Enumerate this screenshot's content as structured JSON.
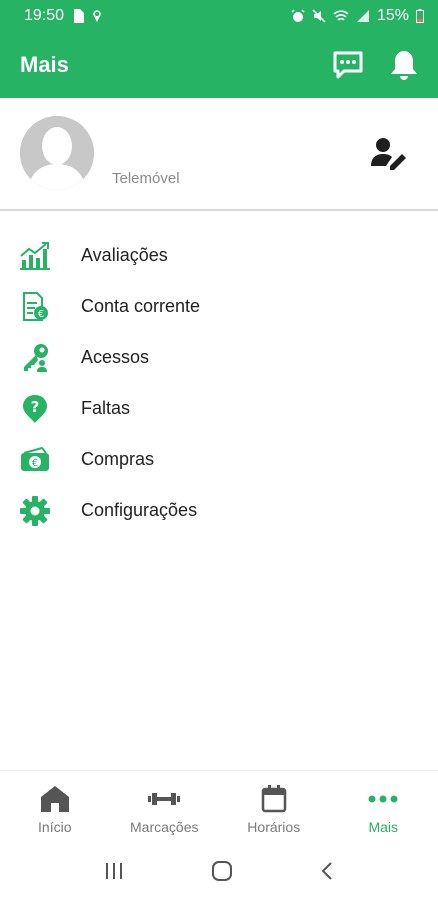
{
  "status": {
    "time": "19:50",
    "battery": "15%"
  },
  "header": {
    "title": "Mais"
  },
  "profile": {
    "phone_label": "Telemóvel"
  },
  "menu": {
    "items": [
      {
        "label": "Avaliações",
        "icon": "bar-chart-icon"
      },
      {
        "label": "Conta corrente",
        "icon": "invoice-euro-icon"
      },
      {
        "label": "Acessos",
        "icon": "key-icon"
      },
      {
        "label": "Faltas",
        "icon": "question-pin-icon"
      },
      {
        "label": "Compras",
        "icon": "money-icon"
      },
      {
        "label": "Configurações",
        "icon": "gear-icon"
      }
    ]
  },
  "bottom_nav": {
    "items": [
      {
        "label": "Início",
        "icon": "home-icon",
        "active": false
      },
      {
        "label": "Marcações",
        "icon": "dumbbell-icon",
        "active": false
      },
      {
        "label": "Horários",
        "icon": "calendar-icon",
        "active": false
      },
      {
        "label": "Mais",
        "icon": "more-dots-icon",
        "active": true
      }
    ]
  },
  "colors": {
    "brand": "#27b364",
    "inactive": "#555555"
  }
}
